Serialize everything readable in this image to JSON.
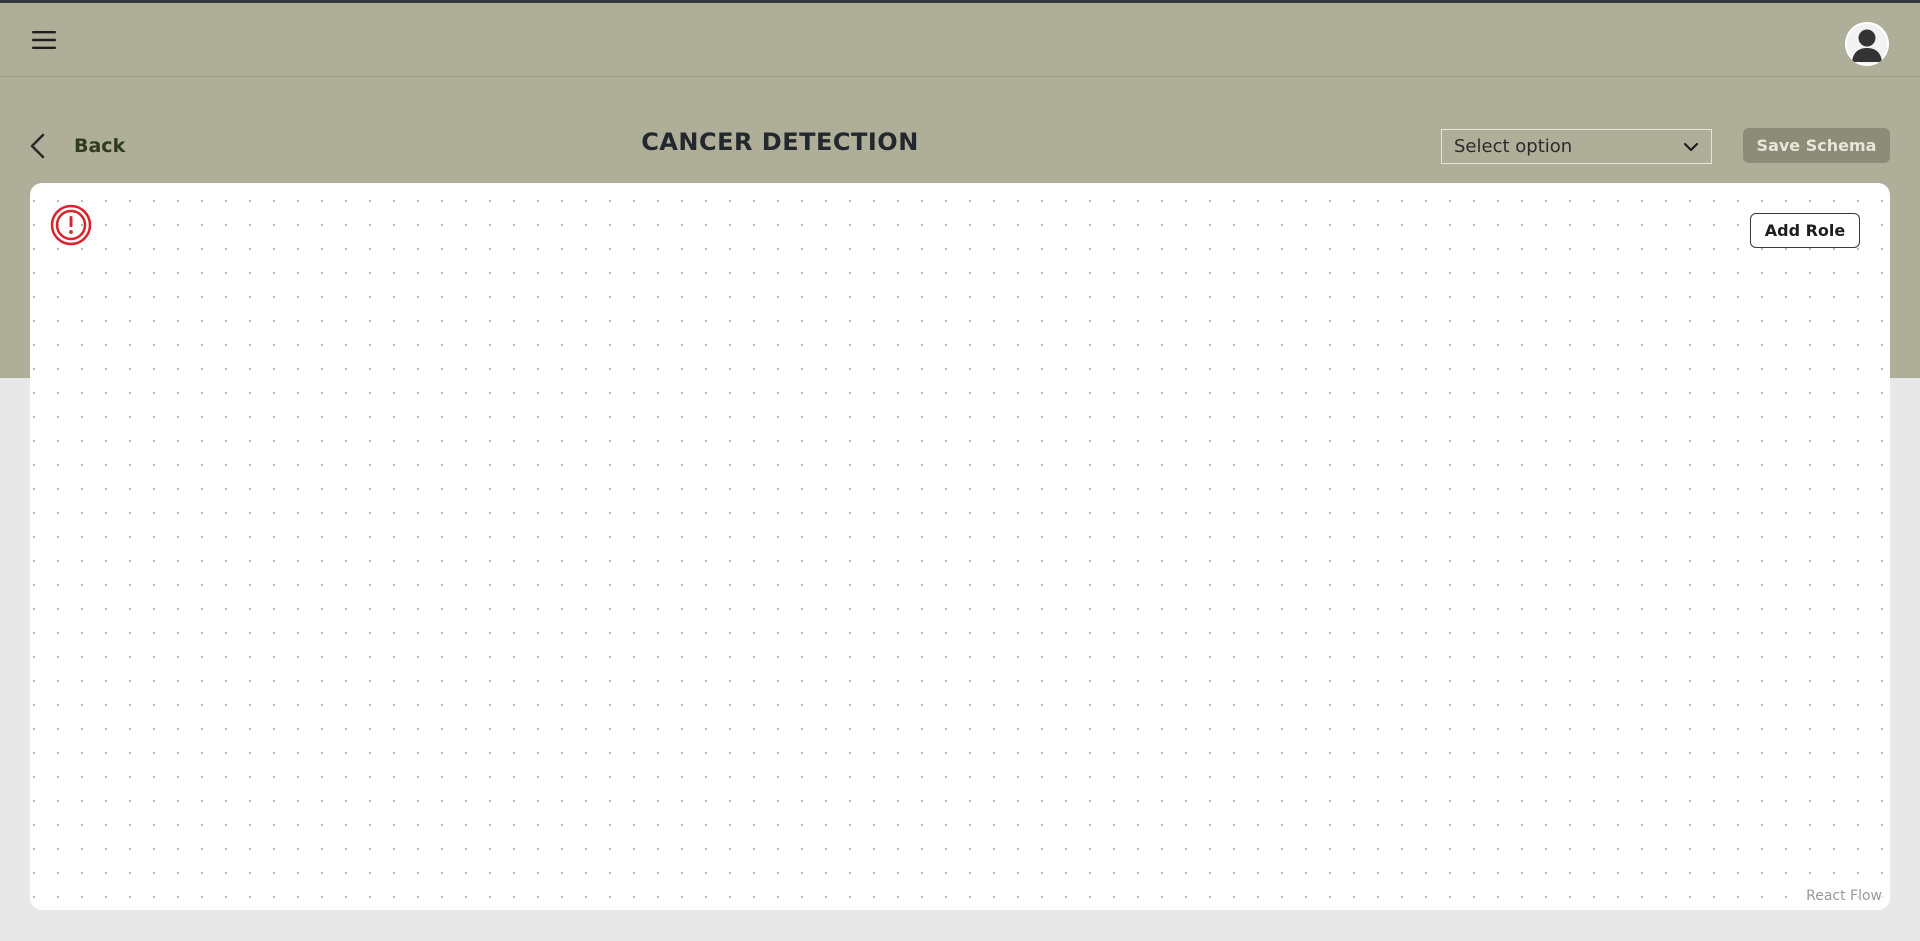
{
  "header": {
    "menu_icon": "hamburger-icon",
    "avatar_icon": "user-avatar-icon"
  },
  "toolbar": {
    "back_label": "Back",
    "title": "CANCER DETECTION",
    "select": {
      "selected_value": "Select option",
      "chevron_icon": "chevron-down-icon"
    },
    "save_label": "Save Schema"
  },
  "flow_canvas": {
    "alert_icon": "alert-circle-icon",
    "add_role_label": "Add Role",
    "attribution": "React Flow"
  },
  "colors": {
    "header_background": "#aeae99",
    "page_background": "#e8e8e8",
    "save_button": "#8c8c78",
    "alert": "#d9232d"
  }
}
